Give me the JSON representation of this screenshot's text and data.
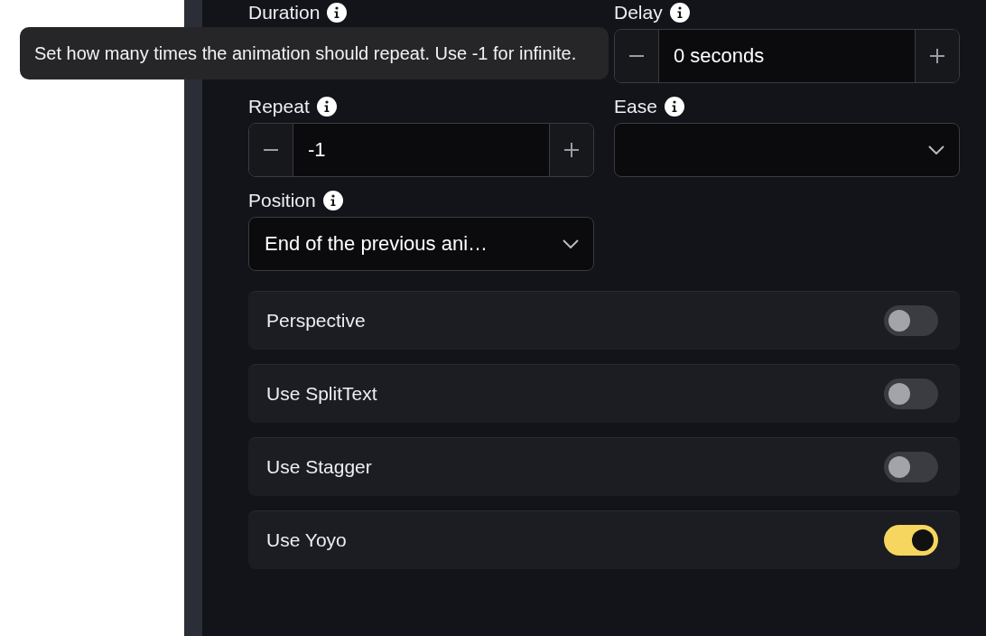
{
  "tooltip": {
    "text": "Set how many times the animation should repeat. Use -1 for infinite."
  },
  "fields": [
    {
      "kind": "stepper",
      "label": "Duration"
    },
    {
      "kind": "stepper",
      "label": "Delay",
      "value": "0 seconds"
    },
    {
      "kind": "stepper",
      "label": "Repeat",
      "value": "-1"
    },
    {
      "kind": "select",
      "label": "Ease"
    },
    {
      "kind": "select",
      "label": "Position",
      "value": "End of the previous ani…"
    }
  ],
  "toggles": [
    {
      "label": "Perspective",
      "on": false
    },
    {
      "label": "Use SplitText",
      "on": false
    },
    {
      "label": "Use Stagger",
      "on": false
    },
    {
      "label": "Use Yoyo",
      "on": true
    }
  ]
}
